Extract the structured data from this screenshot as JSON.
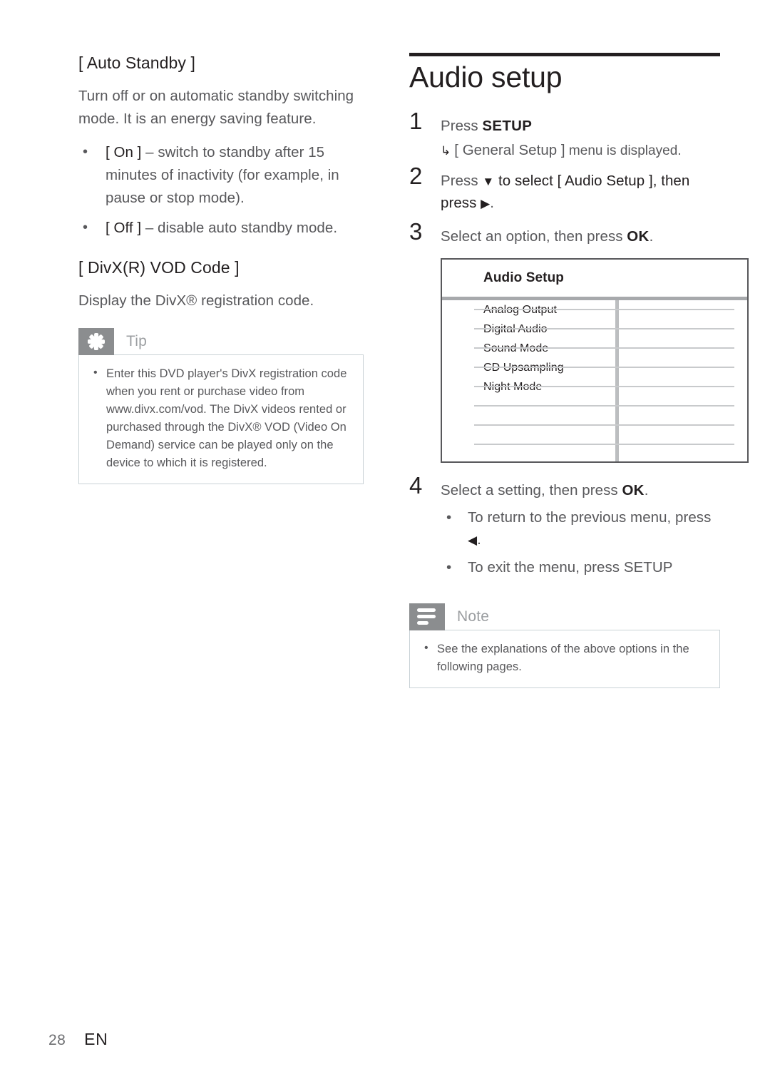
{
  "page": {
    "footer_page_number": "28",
    "footer_language": "EN"
  },
  "left_column": {
    "section1": {
      "heading": "[ Auto Standby ]",
      "paragraph": "Turn off or on automatic standby switching mode. It is an energy saving feature.",
      "bullets": [
        {
          "label": "[ On ]",
          "text": " – switch to standby after 15 minutes of inactivity (for example, in pause or stop mode)."
        },
        {
          "label": "[ Off ]",
          "text": " – disable auto standby mode."
        }
      ]
    },
    "section2": {
      "heading": "[ DivX(R) VOD Code ]",
      "paragraph": "Display the DivX® registration code."
    },
    "tip": {
      "icon": "asterisk-icon",
      "title": "Tip",
      "items": [
        "Enter this DVD player's DivX registration code when you rent or purchase video from www.divx.com/vod. The DivX videos rented or purchased through the DivX® VOD (Video On Demand) service can be played only on the device to which it is registered."
      ]
    }
  },
  "right_column": {
    "section_title": "Audio setup",
    "steps": [
      {
        "number": "1",
        "text_prefix": "Press ",
        "keyword": "SETUP",
        "text_suffix": "",
        "result_arrow": "↳",
        "result_bracket": "[ General Setup ]",
        "result_text": " menu is displayed."
      },
      {
        "number": "2",
        "text_prefix": "Press ",
        "glyph_down": "▼",
        "text_mid": " to select ",
        "bracket": "[ Audio Setup ]",
        "text_after_bracket": ", then press ",
        "glyph_right": "▶",
        "text_end": "."
      },
      {
        "number": "3",
        "text_prefix": "Select an option, then press ",
        "keyword": "OK",
        "text_suffix": "."
      },
      {
        "number": "4",
        "text_prefix": "Select a setting, then press ",
        "keyword": "OK",
        "text_suffix": ".",
        "bullets": [
          {
            "text_before": "To return to the previous menu, press ",
            "glyph": "◀",
            "text_after": "."
          },
          {
            "text_before": "To exit the menu, press ",
            "keyword": "SETUP",
            "text_after": ""
          }
        ]
      }
    ],
    "osd_table": {
      "title": "Audio Setup",
      "rows": [
        {
          "label": "Analog Output",
          "value": ""
        },
        {
          "label": "Digital Audio",
          "value": ""
        },
        {
          "label": "Sound Mode",
          "value": ""
        },
        {
          "label": "CD Upsampling",
          "value": ""
        },
        {
          "label": "Night Mode",
          "value": ""
        },
        {
          "label": "",
          "value": ""
        },
        {
          "label": "",
          "value": ""
        },
        {
          "label": "",
          "value": ""
        }
      ]
    },
    "note": {
      "icon": "note-lines-icon",
      "title": "Note",
      "items": [
        "See the explanations of the above options in the following pages."
      ]
    }
  },
  "colors": {
    "callout_icon_bg": "#8b8d8f",
    "callout_border": "#c9d2d6",
    "rule_black": "#231f20",
    "osd_border": "#58585b",
    "osd_header_rule": "#a7a9ac",
    "osd_divider": "#bcbec0"
  }
}
